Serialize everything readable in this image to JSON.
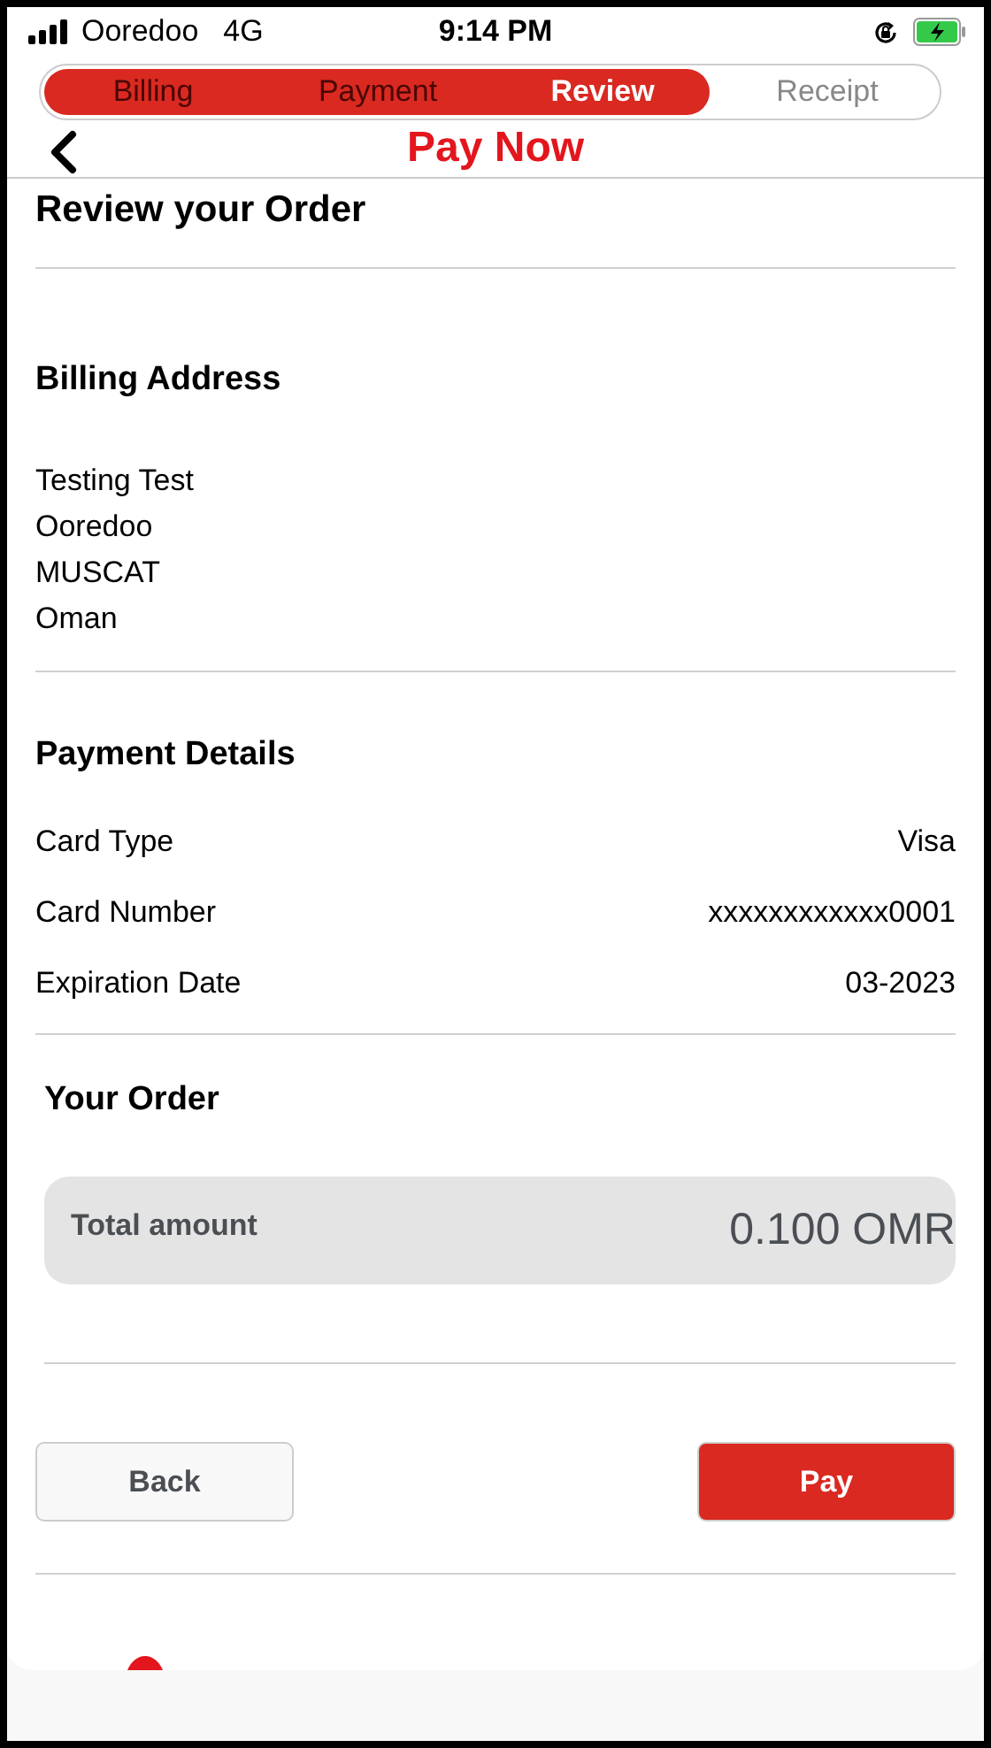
{
  "status_bar": {
    "carrier": "Ooredoo",
    "network": "4G",
    "time": "9:14 PM"
  },
  "header": {
    "title": "Pay Now"
  },
  "stepper": {
    "level": 0.74,
    "steps": [
      {
        "label": "Billing",
        "selected": false
      },
      {
        "label": "Payment",
        "selected": false
      },
      {
        "label": "Review",
        "selected": true
      },
      {
        "label": "Receipt",
        "selected": false
      }
    ]
  },
  "page_title": "Review your Order",
  "billing": {
    "heading": "Billing Address",
    "lines": [
      "Testing Test",
      "Ooredoo",
      "MUSCAT",
      "Oman"
    ]
  },
  "payment": {
    "heading": "Payment Details",
    "rows": [
      {
        "label": "Card Type",
        "value": "Visa"
      },
      {
        "label": "Card Number",
        "value": "xxxxxxxxxxxx0001"
      },
      {
        "label": "Expiration Date",
        "value": "03-2023"
      }
    ]
  },
  "order": {
    "heading": "Your Order",
    "total_label": "Total amount",
    "total_value": "0.100 OMR"
  },
  "buttons": [
    {
      "label": "Back",
      "kind": "secondary"
    },
    {
      "label": "Pay",
      "kind": "primary"
    }
  ]
}
